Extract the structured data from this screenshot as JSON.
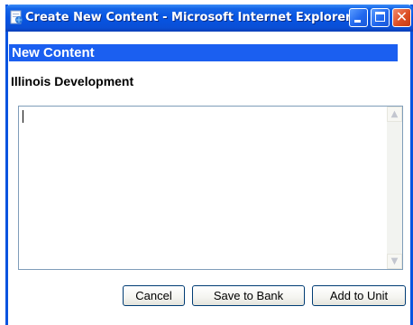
{
  "window": {
    "title": "Create New Content - Microsoft Internet Explorer",
    "controls": {
      "close_glyph": "✕"
    }
  },
  "dialog": {
    "header": "New Content",
    "unit_name": "Illinois Development",
    "content": {
      "value": ""
    },
    "scroll": {
      "up_glyph": "▲",
      "down_glyph": "▼"
    },
    "buttons": {
      "cancel": "Cancel",
      "save_to_bank": "Save to Bank",
      "add_to_unit": "Add to Unit"
    }
  },
  "colors": {
    "titlebar": "#0654e2",
    "header_bar": "#1b5ff0",
    "window_border": "#0a54e0",
    "close_button": "#dc4e24"
  },
  "icons": {
    "title": "internet-explorer-page-icon",
    "minimize": "minimize-icon",
    "maximize": "maximize-icon",
    "close": "close-icon"
  }
}
